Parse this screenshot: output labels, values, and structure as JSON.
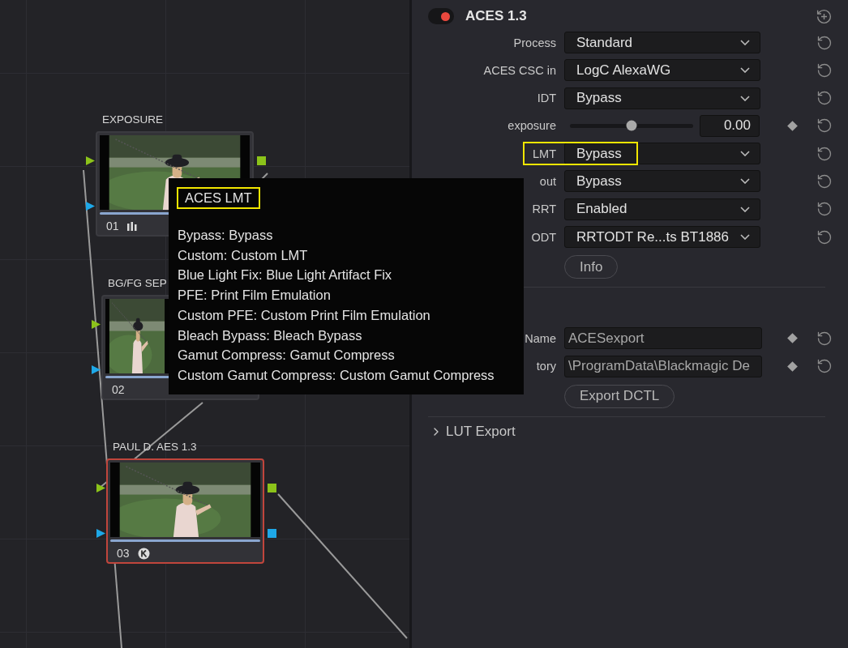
{
  "node_editor": {
    "nodes": [
      {
        "title": "EXPOSURE",
        "number": "01",
        "selected": false,
        "kind": "levels"
      },
      {
        "title": "BG/FG SEP",
        "number": "02",
        "selected": false,
        "kind": "plain"
      },
      {
        "title": "PAUL D. AES 1.3",
        "number": "03",
        "selected": true,
        "kind": "k_badge"
      }
    ]
  },
  "tooltip": {
    "title": "ACES LMT",
    "title_highlighted": true,
    "lines": [
      "Bypass: Bypass",
      "Custom: Custom LMT",
      "Blue Light Fix: Blue Light Artifact Fix",
      "PFE: Print Film Emulation",
      "Custom PFE: Custom Print Film Emulation",
      "Bleach Bypass: Bleach Bypass",
      "Gamut Compress: Gamut Compress",
      "Custom Gamut Compress: Custom Gamut Compress"
    ]
  },
  "inspector": {
    "title": "ACES 1.3",
    "enabled": true,
    "rows": [
      {
        "kind": "dropdown",
        "label": "Process",
        "value": "Standard",
        "highlighted": false
      },
      {
        "kind": "dropdown",
        "label": "ACES CSC in",
        "value": "LogC AlexaWG",
        "highlighted": false
      },
      {
        "kind": "dropdown",
        "label": "IDT",
        "value": "Bypass",
        "highlighted": false
      },
      {
        "kind": "slider",
        "label": "exposure",
        "level": 0.5,
        "value": "0.00",
        "keyframe": true
      },
      {
        "kind": "dropdown",
        "label": "LMT",
        "value": "Bypass",
        "highlighted": true
      },
      {
        "kind": "dropdown",
        "label": "out",
        "value": "Bypass",
        "highlighted": false
      },
      {
        "kind": "dropdown",
        "label": "RRT",
        "value": "Enabled",
        "highlighted": false
      },
      {
        "kind": "dropdown",
        "label": "ODT",
        "value": "RRTODT Re...ts BT1886",
        "highlighted": false
      }
    ],
    "info_button": "Info",
    "dctl_export": {
      "fields": [
        {
          "label": "Name",
          "value": "ACESexport"
        },
        {
          "label": "tory",
          "value": "\\ProgramData\\Blackmagic De"
        }
      ],
      "button": "Export DCTL"
    },
    "lut_export": {
      "title": "LUT Export",
      "expanded": false
    }
  }
}
